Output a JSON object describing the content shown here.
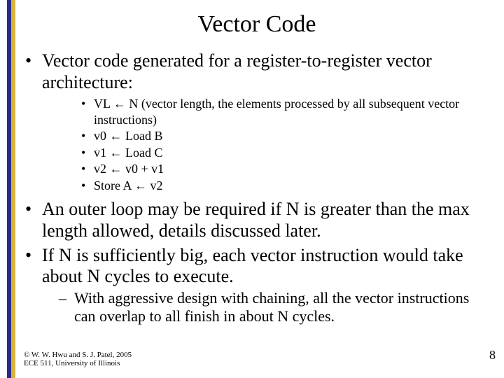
{
  "title": "Vector Code",
  "bullets": {
    "b1": "Vector code generated for a register-to-register vector architecture:",
    "sub": {
      "s1": "VL ← N (vector length, the elements processed by all subsequent vector instructions)",
      "s2": "v0 ← Load B",
      "s3": "v1 ← Load C",
      "s4": "v2 ← v0 + v1",
      "s5": "Store A ← v2"
    },
    "b2": "An outer loop may be required if N is greater than the max length allowed, details discussed later.",
    "b3": "If N is sufficiently big, each vector instruction would take about N cycles to execute.",
    "b3dash": "With aggressive design with chaining, all the vector instructions can overlap to all finish in about N cycles."
  },
  "footer": {
    "line1": "© W. W. Hwu and S. J. Patel, 2005",
    "line2": "ECE 511, University of Illinois"
  },
  "page": "8"
}
